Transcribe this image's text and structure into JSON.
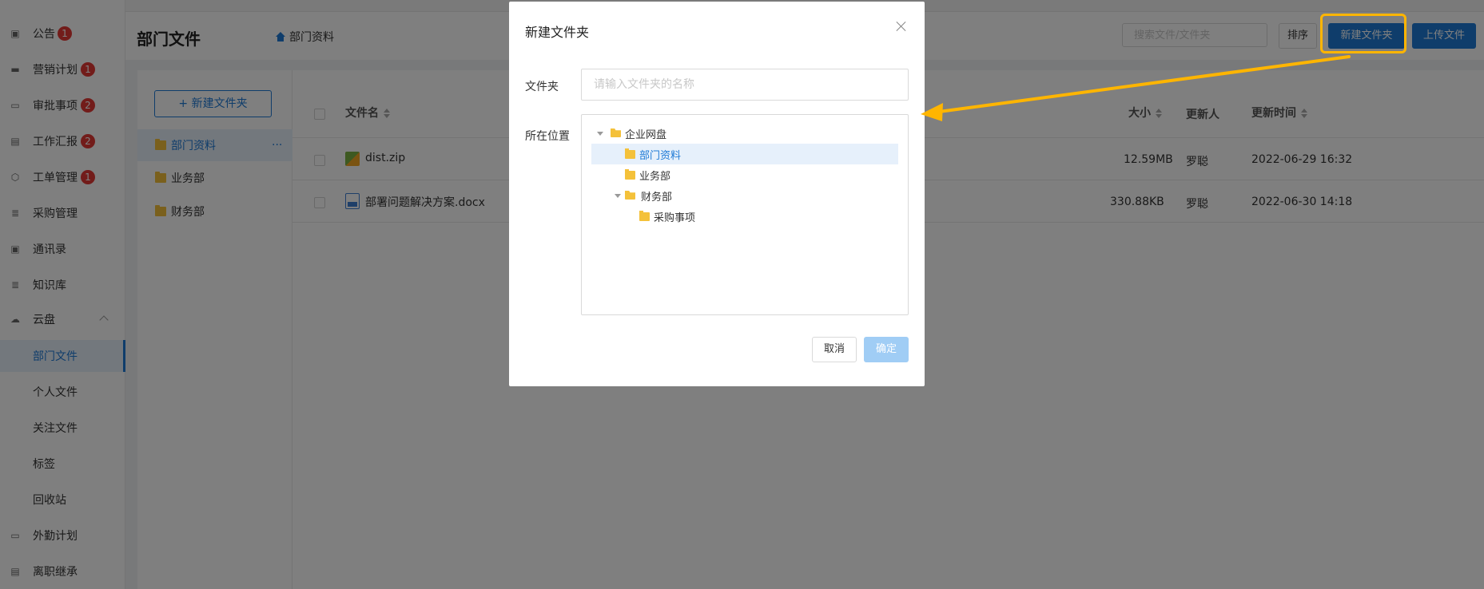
{
  "sidebar": {
    "items": [
      {
        "label": "公告",
        "badge": "1",
        "icon": "notice-icon"
      },
      {
        "label": "营销计划",
        "badge": "1",
        "icon": "briefcase-icon"
      },
      {
        "label": "审批事项",
        "badge": "2",
        "icon": "calendar-icon"
      },
      {
        "label": "工作汇报",
        "badge": "2",
        "icon": "document-icon"
      },
      {
        "label": "工单管理",
        "badge": "1",
        "icon": "box-icon"
      },
      {
        "label": "采购管理",
        "badge": "",
        "icon": "database-icon"
      },
      {
        "label": "通讯录",
        "badge": "",
        "icon": "contacts-icon"
      },
      {
        "label": "知识库",
        "badge": "",
        "icon": "database-icon"
      },
      {
        "label": "云盘",
        "badge": "",
        "icon": "cloud-icon"
      }
    ],
    "cloud_sub": [
      {
        "label": "部门文件",
        "active": true
      },
      {
        "label": "个人文件"
      },
      {
        "label": "关注文件"
      },
      {
        "label": "标签"
      },
      {
        "label": "回收站"
      }
    ],
    "bottom_items": [
      {
        "label": "外勤计划",
        "icon": "calendar-icon"
      },
      {
        "label": "离职继承",
        "icon": "id-card-icon"
      }
    ]
  },
  "header": {
    "title": "部门文件",
    "breadcrumb": "部门资料",
    "search_placeholder": "搜索文件/文件夹",
    "sort_label": "排序",
    "new_folder_label": "新建文件夹",
    "upload_label": "上传文件"
  },
  "folders": {
    "new_folder_btn": "+ 新建文件夹",
    "items": [
      "部门资料",
      "业务部",
      "财务部"
    ],
    "more": "···"
  },
  "table": {
    "headers": {
      "name": "文件名",
      "size": "大小",
      "updater": "更新人",
      "time": "更新时间"
    },
    "rows": [
      {
        "name": "dist.zip",
        "size": "12.59MB",
        "updater": "罗聪",
        "time": "2022-06-29 16:32"
      },
      {
        "name": "部署问题解决方案.docx",
        "size": "330.88KB",
        "updater": "罗聪",
        "time": "2022-06-30 14:18"
      }
    ]
  },
  "modal": {
    "title": "新建文件夹",
    "folder_label": "文件夹",
    "folder_placeholder": "请输入文件夹的名称",
    "location_label": "所在位置",
    "tree": {
      "root": "企业网盘",
      "children": [
        "部门资料",
        "业务部",
        "财务部"
      ],
      "grandchild": "采购事项"
    },
    "cancel_label": "取消",
    "ok_label": "确定"
  },
  "colors": {
    "accent": "#1f7ad6",
    "highlight": "#ffb500",
    "badge": "#e53935"
  }
}
